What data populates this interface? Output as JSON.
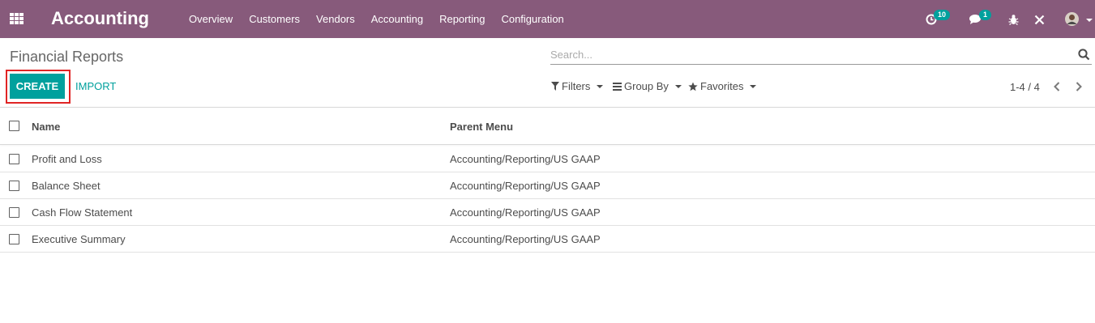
{
  "navbar": {
    "app_title": "Accounting",
    "menu": [
      "Overview",
      "Customers",
      "Vendors",
      "Accounting",
      "Reporting",
      "Configuration"
    ],
    "activity_count": "10",
    "message_count": "1",
    "icons": [
      "apps-grid-icon",
      "activity-clock-icon",
      "chat-icon",
      "bug-icon",
      "tools-icon",
      "user-avatar"
    ]
  },
  "control_panel": {
    "title": "Financial Reports",
    "search_placeholder": "Search...",
    "create_label": "CREATE",
    "import_label": "IMPORT",
    "filters_label": "Filters",
    "group_by_label": "Group By",
    "favorites_label": "Favorites",
    "pager": "1-4 / 4"
  },
  "list": {
    "columns": [
      "Name",
      "Parent Menu"
    ],
    "rows": [
      {
        "name": "Profit and Loss",
        "parent_menu": "Accounting/Reporting/US GAAP"
      },
      {
        "name": "Balance Sheet",
        "parent_menu": "Accounting/Reporting/US GAAP"
      },
      {
        "name": "Cash Flow Statement",
        "parent_menu": "Accounting/Reporting/US GAAP"
      },
      {
        "name": "Executive Summary",
        "parent_menu": "Accounting/Reporting/US GAAP"
      }
    ]
  },
  "colors": {
    "navbar": "#875a7b",
    "primary": "#00a09d",
    "highlight": "#e02424"
  }
}
